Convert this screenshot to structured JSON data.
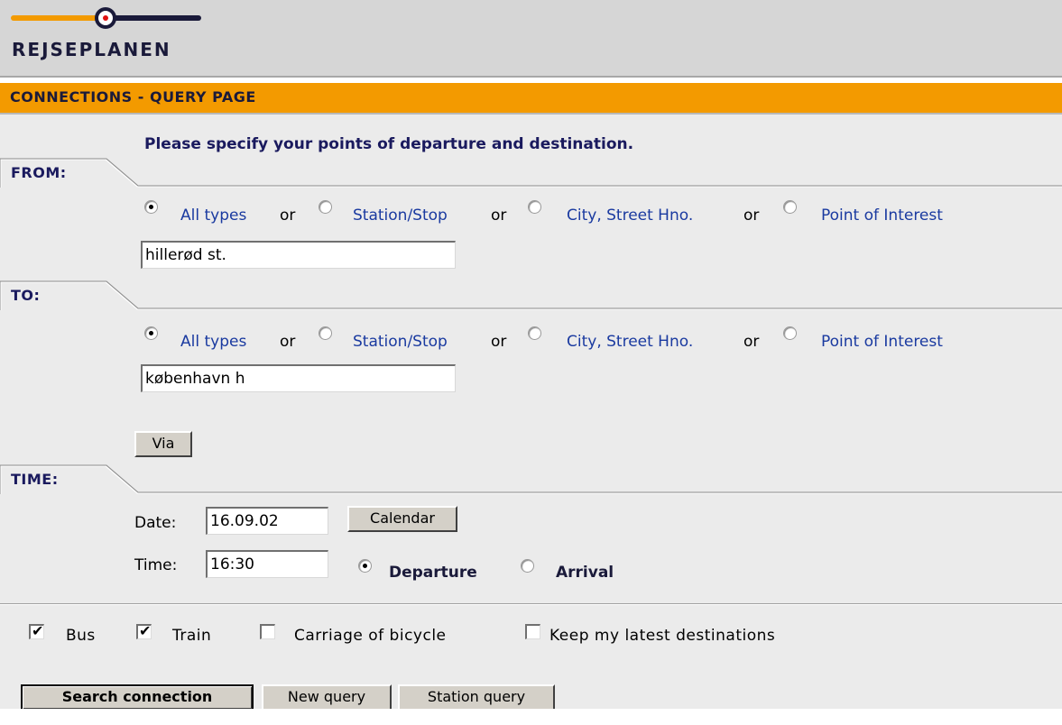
{
  "header": {
    "logo_text": "REJSEPLANEN",
    "colors": {
      "accent": "#f39a00",
      "brand_dark": "#1a1a3a",
      "link": "#1a3aa0"
    }
  },
  "page_title": "CONNECTIONS - QUERY PAGE",
  "intro": "Please specify your points of departure and destination.",
  "from": {
    "label": "FROM:",
    "options": [
      {
        "label": "All types",
        "selected": true
      },
      {
        "label": "Station/Stop",
        "selected": false
      },
      {
        "label": "City, Street Hno.",
        "selected": false
      },
      {
        "label": "Point of Interest",
        "selected": false
      }
    ],
    "separator": "or",
    "value": "hillerød st."
  },
  "to": {
    "label": "TO:",
    "options": [
      {
        "label": "All types",
        "selected": true
      },
      {
        "label": "Station/Stop",
        "selected": false
      },
      {
        "label": "City, Street Hno.",
        "selected": false
      },
      {
        "label": "Point of Interest",
        "selected": false
      }
    ],
    "separator": "or",
    "value": "københavn h"
  },
  "via_button": "Via",
  "time": {
    "label": "TIME:",
    "date_label": "Date:",
    "date_value": "16.09.02",
    "calendar_button": "Calendar",
    "time_label": "Time:",
    "time_value": "16:30",
    "departure_label": "Departure",
    "arrival_label": "Arrival",
    "mode_selected": "Departure"
  },
  "options": [
    {
      "label": "Bus",
      "checked": true
    },
    {
      "label": "Train",
      "checked": true
    },
    {
      "label": "Carriage of bicycle",
      "checked": false
    },
    {
      "label": "Keep my latest destinations",
      "checked": false
    }
  ],
  "buttons": {
    "search": "Search connection",
    "new_query": "New query",
    "station_query": "Station query"
  }
}
